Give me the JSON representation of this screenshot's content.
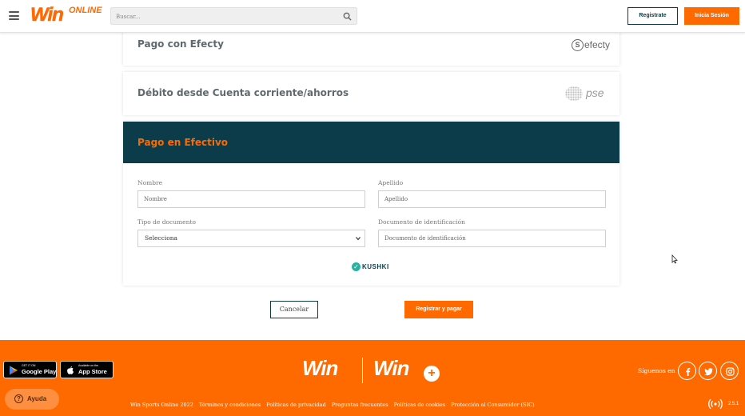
{
  "header": {
    "logo_text": "Win",
    "logo_sub": "ONLINE",
    "search_placeholder": "Buscar...",
    "register_label": "Registrate",
    "login_label": "Inicia Sesión"
  },
  "payment_methods": [
    {
      "title": "Pago con Efecty",
      "logo": "efecty"
    },
    {
      "title": "Débito desde Cuenta corriente/ahorros",
      "logo": "pse"
    }
  ],
  "cash_form": {
    "title": "Pago en Efectivo",
    "first_name": {
      "label": "Nombre",
      "placeholder": "Nombre"
    },
    "last_name": {
      "label": "Apellido",
      "placeholder": "Apellido"
    },
    "doc_type": {
      "label": "Tipo de documento",
      "value": "Selecciona"
    },
    "doc_number": {
      "label": "Documento de identificación",
      "placeholder": "Documento de identificación"
    },
    "provider": "KUSHKI"
  },
  "actions": {
    "cancel_label": "Cancelar",
    "pay_label": "Registrar y pagar"
  },
  "footer": {
    "google_play_small": "GET IT ON",
    "google_play_big": "Google Play",
    "app_store_small": "Available on the",
    "app_store_big": "App Store",
    "help_label": "Ayuda",
    "logo_left": "Win",
    "logo_right": "Win",
    "follow_label": "Síguenos en",
    "links": [
      "Win Sports Online 2022",
      "Términos y condiciones",
      "Políticas de privacidad",
      "Preguntas frecuentes",
      "Políticas de cookies",
      "Protección al Consumidor (SIC)"
    ],
    "version": "2.5.1"
  },
  "colors": {
    "brand_orange": "#ff6a00",
    "dark_teal": "#0c3b49"
  },
  "icons": [
    "hamburger-icon",
    "search-icon",
    "check-circle-icon",
    "chevron-down-icon",
    "facebook-icon",
    "twitter-icon",
    "instagram-icon",
    "help-icon",
    "radio-icon",
    "cursor-icon"
  ]
}
